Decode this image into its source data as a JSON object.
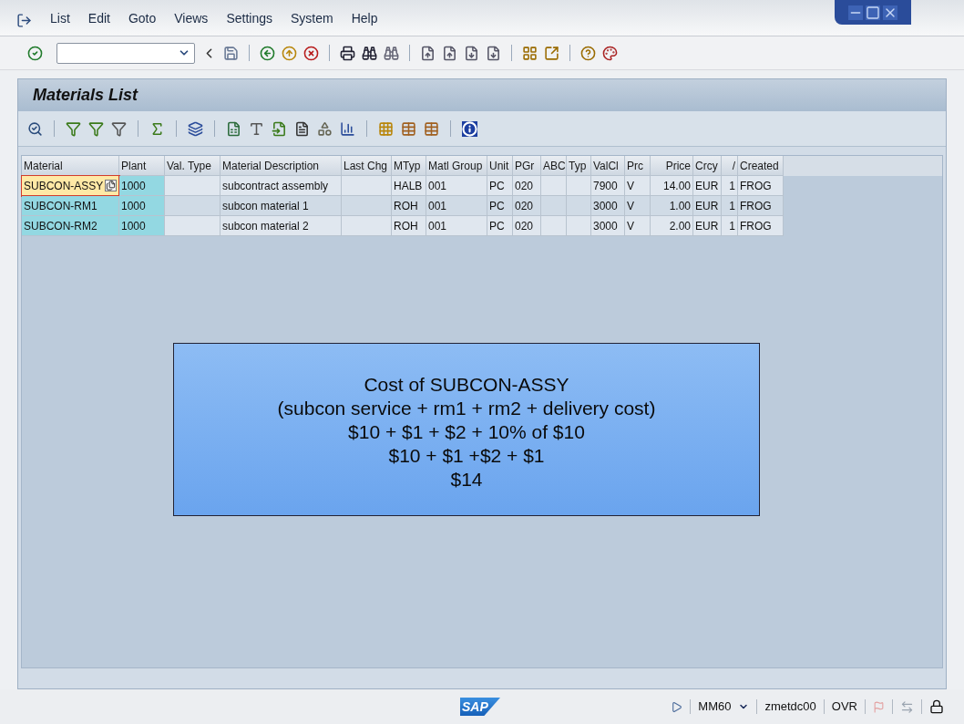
{
  "menu": [
    "List",
    "Edit",
    "Goto",
    "Views",
    "Settings",
    "System",
    "Help"
  ],
  "title": "Materials List",
  "table": {
    "columns": [
      {
        "label": "Material",
        "key": true,
        "kind": "text"
      },
      {
        "label": "Plant",
        "key": true,
        "kind": "text"
      },
      {
        "label": "Val. Type",
        "key": false,
        "kind": "text"
      },
      {
        "label": "Material Description",
        "key": false,
        "kind": "text"
      },
      {
        "label": "Last Chg",
        "key": false,
        "kind": "text"
      },
      {
        "label": "MTyp",
        "key": false,
        "kind": "text"
      },
      {
        "label": "Matl Group",
        "key": false,
        "kind": "text"
      },
      {
        "label": "Unit",
        "key": false,
        "kind": "text"
      },
      {
        "label": "PGr",
        "key": false,
        "kind": "text"
      },
      {
        "label": "ABC",
        "key": false,
        "kind": "text"
      },
      {
        "label": "Typ",
        "key": false,
        "kind": "text"
      },
      {
        "label": "ValCl",
        "key": false,
        "kind": "text"
      },
      {
        "label": "Prc",
        "key": false,
        "kind": "text"
      },
      {
        "label": "Price",
        "key": false,
        "kind": "number"
      },
      {
        "label": "Crcy",
        "key": false,
        "kind": "text"
      },
      {
        "label": "/",
        "key": false,
        "kind": "number"
      },
      {
        "label": "Created",
        "key": false,
        "kind": "text"
      }
    ],
    "rows": [
      {
        "focused": true,
        "cells": [
          "SUBCON-ASSY",
          "1000",
          "",
          "subcontract assembly",
          "",
          "HALB",
          "001",
          "PC",
          "020",
          "",
          "",
          "7900",
          "V",
          "14.00",
          "EUR",
          "1",
          "FROG"
        ]
      },
      {
        "focused": false,
        "cells": [
          "SUBCON-RM1",
          "1000",
          "",
          "subcon material 1",
          "",
          "ROH",
          "001",
          "PC",
          "020",
          "",
          "",
          "3000",
          "V",
          "1.00",
          "EUR",
          "1",
          "FROG"
        ]
      },
      {
        "focused": false,
        "cells": [
          "SUBCON-RM2",
          "1000",
          "",
          "subcon material 2",
          "",
          "ROH",
          "001",
          "PC",
          "020",
          "",
          "",
          "3000",
          "V",
          "2.00",
          "EUR",
          "1",
          "FROG"
        ]
      }
    ]
  },
  "note": [
    "Cost of SUBCON-ASSY",
    "(subcon service + rm1 + rm2 + delivery cost)",
    "$10 + $1 + $2 + 10% of $10",
    "$10 + $1 +$2 + $1",
    "$14"
  ],
  "status": {
    "logo": "SAP",
    "transaction": "MM60",
    "server": "zmetdc00",
    "mode": "OVR"
  }
}
